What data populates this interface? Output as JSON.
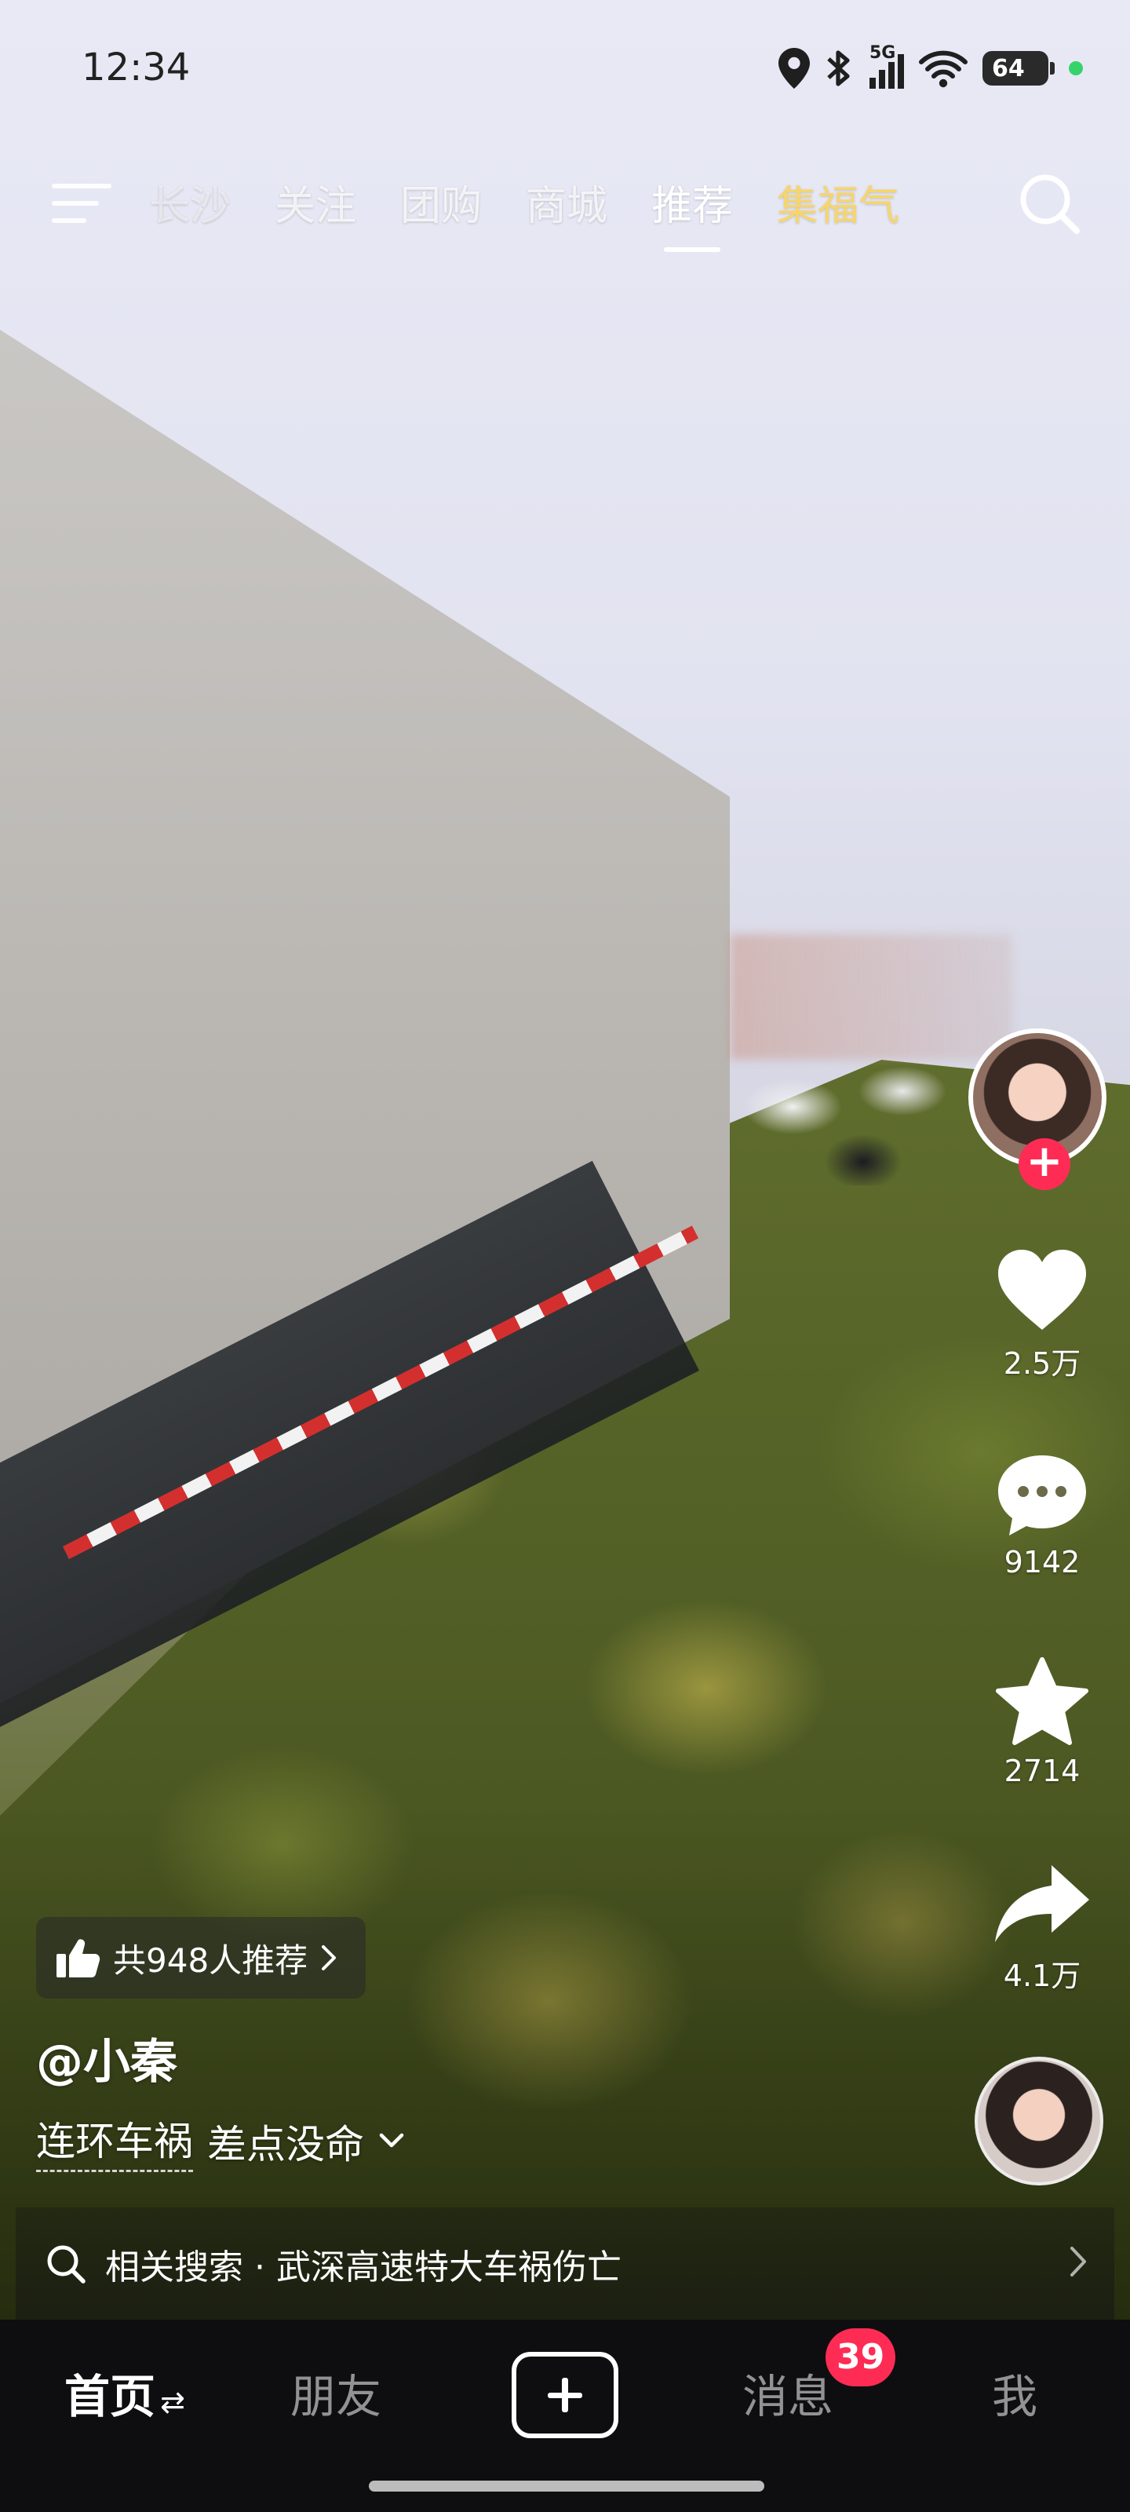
{
  "status_bar": {
    "time": "12:34",
    "network": "5G",
    "battery": "64"
  },
  "top_nav": {
    "tabs": [
      "长沙",
      "关注",
      "团购",
      "商城",
      "推荐",
      "集福气"
    ],
    "active_tab": "推荐"
  },
  "actions": {
    "likes": "2.5万",
    "comments": "9142",
    "favorites": "2714",
    "shares": "4.1万"
  },
  "video_info": {
    "recommend": "共948人推荐",
    "author": "@小秦",
    "hashtag": "连环车祸",
    "caption": "差点没命"
  },
  "related_search": {
    "text": "相关搜索 · 武深高速特大车祸伤亡"
  },
  "bottom_nav": {
    "home": "首页",
    "friends": "朋友",
    "messages": "消息",
    "messages_badge": "39",
    "me": "我"
  },
  "colors": {
    "accent_red": "#fe2c55",
    "special_tab": "#f7d56a"
  }
}
